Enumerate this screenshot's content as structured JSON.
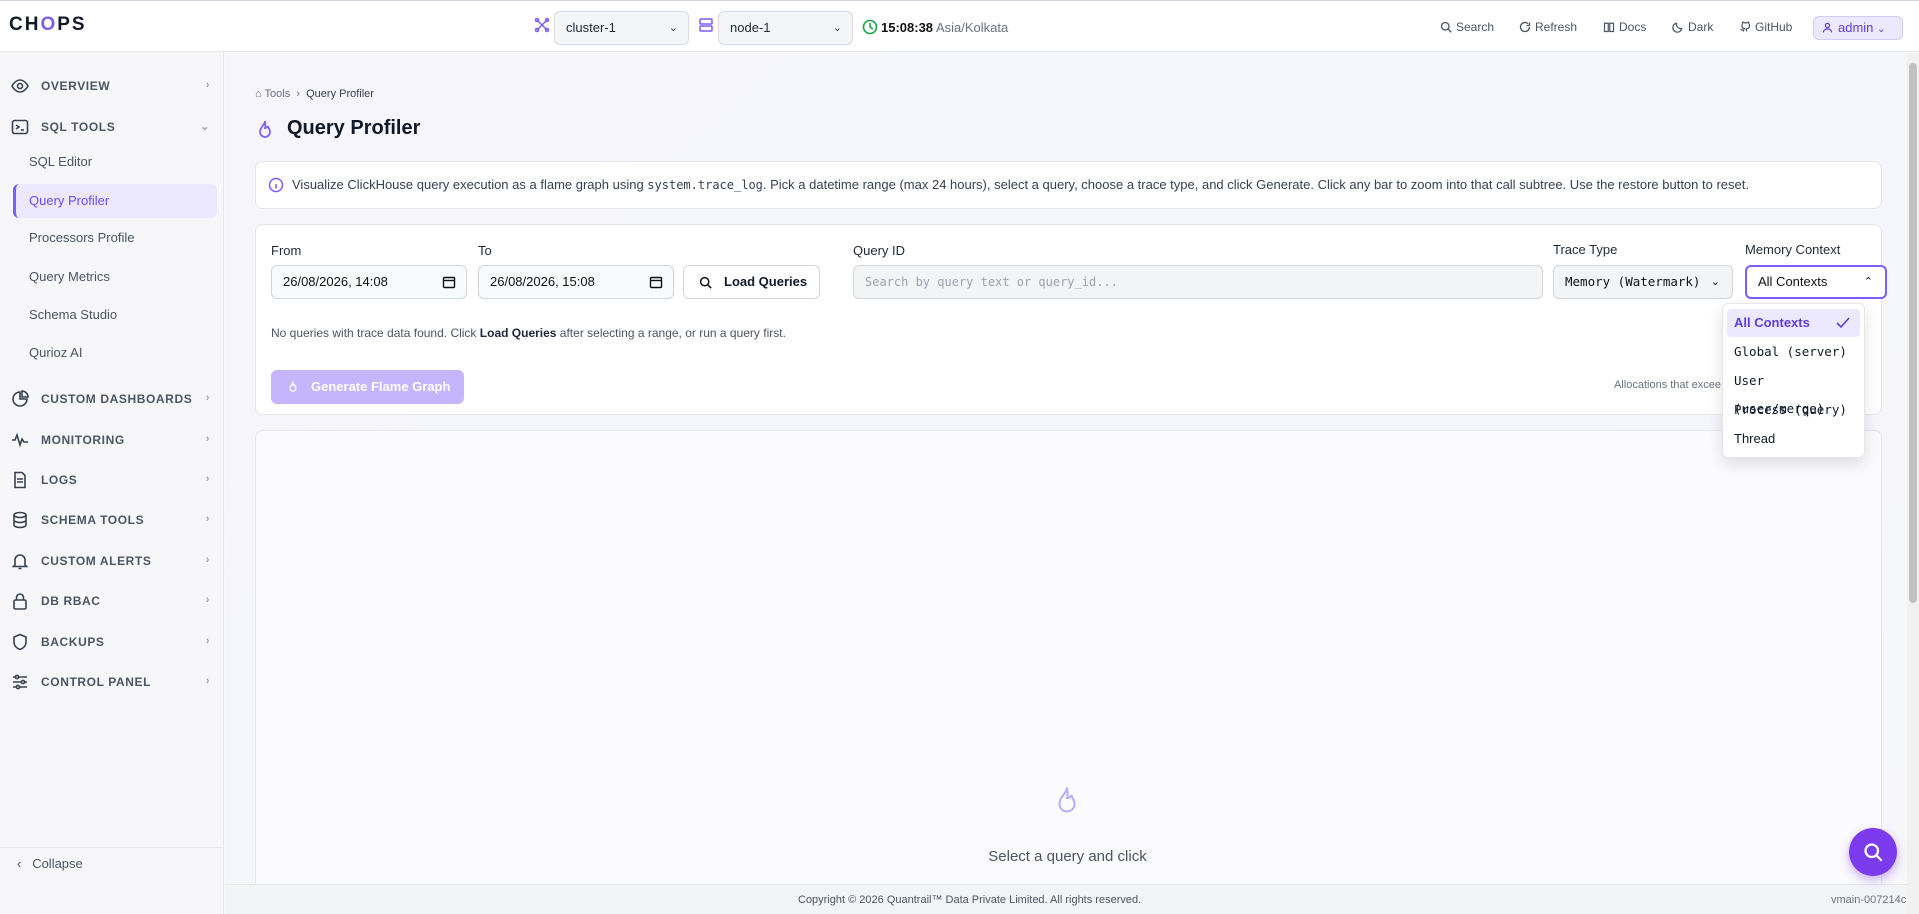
{
  "app": {
    "logo_pre": "CH",
    "logo_o": "O",
    "logo_post": "PS"
  },
  "topbar": {
    "cluster": "cluster-1",
    "node": "node-1",
    "time": "15:08:38",
    "timezone": "Asia/Kolkata",
    "search": "Search",
    "refresh": "Refresh",
    "docs": "Docs",
    "theme": "Dark",
    "github": "GitHub",
    "user": "admin"
  },
  "sidebar": {
    "overview": "OVERVIEW",
    "sql_tools": "SQL TOOLS",
    "sql_items": [
      "SQL Editor",
      "Query Profiler",
      "Processors Profile",
      "Query Metrics",
      "Schema Studio",
      "Qurioz AI"
    ],
    "custom_dashboards": "CUSTOM DASHBOARDS",
    "monitoring": "MONITORING",
    "logs": "LOGS",
    "schema_tools": "SCHEMA TOOLS",
    "custom_alerts": "CUSTOM ALERTS",
    "db_rbac": "DB RBAC",
    "backups": "BACKUPS",
    "control_panel": "CONTROL PANEL",
    "collapse": "Collapse"
  },
  "breadcrumb": {
    "root": "Tools",
    "current": "Query Profiler"
  },
  "page": {
    "title": "Query Profiler"
  },
  "info": {
    "pre": "Visualize ClickHouse query execution as a flame graph using ",
    "code": "system.trace_log",
    "post": ". Pick a datetime range (max 24 hours), select a query, choose a trace type, and click Generate. Click any bar to zoom into that call subtree. Use the restore button to reset."
  },
  "form": {
    "from_label": "From",
    "from_value": "26/08/2026, 14:08",
    "to_label": "To",
    "to_value": "26/08/2026, 15:08",
    "load_queries": "Load Queries",
    "query_id_label": "Query ID",
    "query_id_placeholder": "Search by query text or query_id...",
    "trace_type_label": "Trace Type",
    "trace_type_value": "Memory (Watermark)",
    "memory_context_label": "Memory Context",
    "memory_context_value": "All Contexts",
    "no_data_pre": "No queries with trace data found. Click ",
    "no_data_bold": "Load Queries",
    "no_data_post": " after selecting a range, or run a query first.",
    "generate": "Generate Flame Graph",
    "alloc_note": "Allocations that excee"
  },
  "dropdown": {
    "options": [
      "All Contexts",
      "Global (server)",
      "User (user/merge)",
      "Process (query)",
      "Thread"
    ]
  },
  "empty": {
    "text": "Select a query and click"
  },
  "footer": {
    "copyright": "Copyright © 2026 Quantrail™ Data Private Limited. All rights reserved.",
    "version": "vmain-007214c"
  },
  "colors": {
    "accent": "#7c5cff",
    "accent_dark": "#7c3aed",
    "selected_bg": "#ece8fd"
  }
}
